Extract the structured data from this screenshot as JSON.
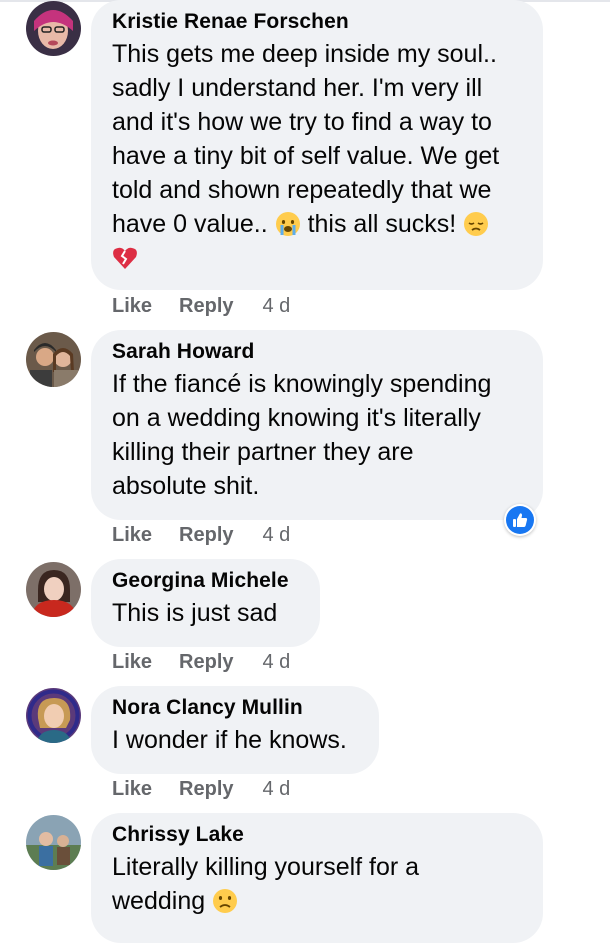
{
  "comments": [
    {
      "author": "Kristie Renae Forschen",
      "text_lines": [
        "This gets me deep inside my soul..",
        "sadly I understand her. I'm very ill",
        "and it's how we try to find a way to",
        "have a tiny bit of self value. We get",
        "told and shown repeatedly that we"
      ],
      "last_line_a": "have 0 value.. ",
      "last_line_b": " this all sucks! ",
      "emojis": [
        "crying-face-icon",
        "disappointed-face-icon",
        "broken-heart-icon"
      ],
      "like_label": "Like",
      "reply_label": "Reply",
      "time": "4 d"
    },
    {
      "author": "Sarah Howard",
      "text_lines": [
        "If the fiancé is knowingly spending",
        "on a wedding knowing it's literally",
        "killing their partner they are",
        "absolute shit."
      ],
      "reaction": "like-reaction-icon",
      "like_label": "Like",
      "reply_label": "Reply",
      "time": "4 d"
    },
    {
      "author": "Georgina Michele",
      "text_lines": [
        "This is just sad"
      ],
      "like_label": "Like",
      "reply_label": "Reply",
      "time": "4 d"
    },
    {
      "author": "Nora Clancy Mullin",
      "text_lines": [
        "I wonder if he knows."
      ],
      "like_label": "Like",
      "reply_label": "Reply",
      "time": "4 d"
    },
    {
      "author": "Chrissy Lake",
      "text_lines": [
        "Literally killing yourself for a"
      ],
      "last_line_a": "wedding ",
      "emojis": [
        "frowning-face-icon"
      ]
    }
  ],
  "colors": {
    "bubble": "#f0f2f5",
    "text": "#050505",
    "meta": "#65676b",
    "like_blue": "#1877f2"
  }
}
